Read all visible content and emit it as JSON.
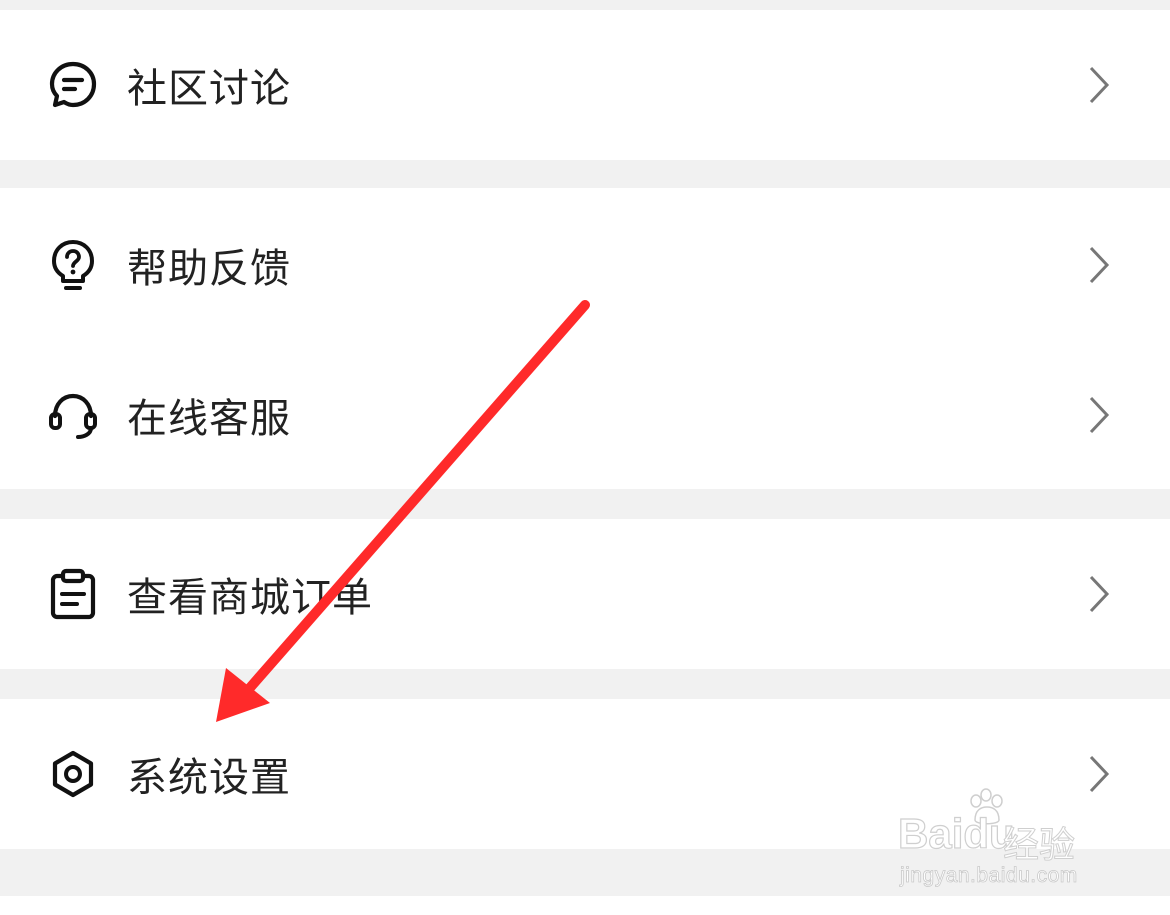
{
  "menu": {
    "items": [
      {
        "label": "社区讨论",
        "icon": "chat-bubble-icon"
      },
      {
        "label": "帮助反馈",
        "icon": "help-lightbulb-icon"
      },
      {
        "label": "在线客服",
        "icon": "headset-icon"
      },
      {
        "label": "查看商城订单",
        "icon": "clipboard-icon"
      },
      {
        "label": "系统设置",
        "icon": "hexagon-settings-icon"
      }
    ]
  },
  "watermark": {
    "brand": "Baidu",
    "product": "经验",
    "url": "jingyan.baidu.com"
  },
  "annotation": {
    "arrow_color": "#ff2a2a"
  },
  "colors": {
    "background": "#f1f1f1",
    "card": "#ffffff",
    "text": "#222222",
    "chevron": "#777777"
  }
}
